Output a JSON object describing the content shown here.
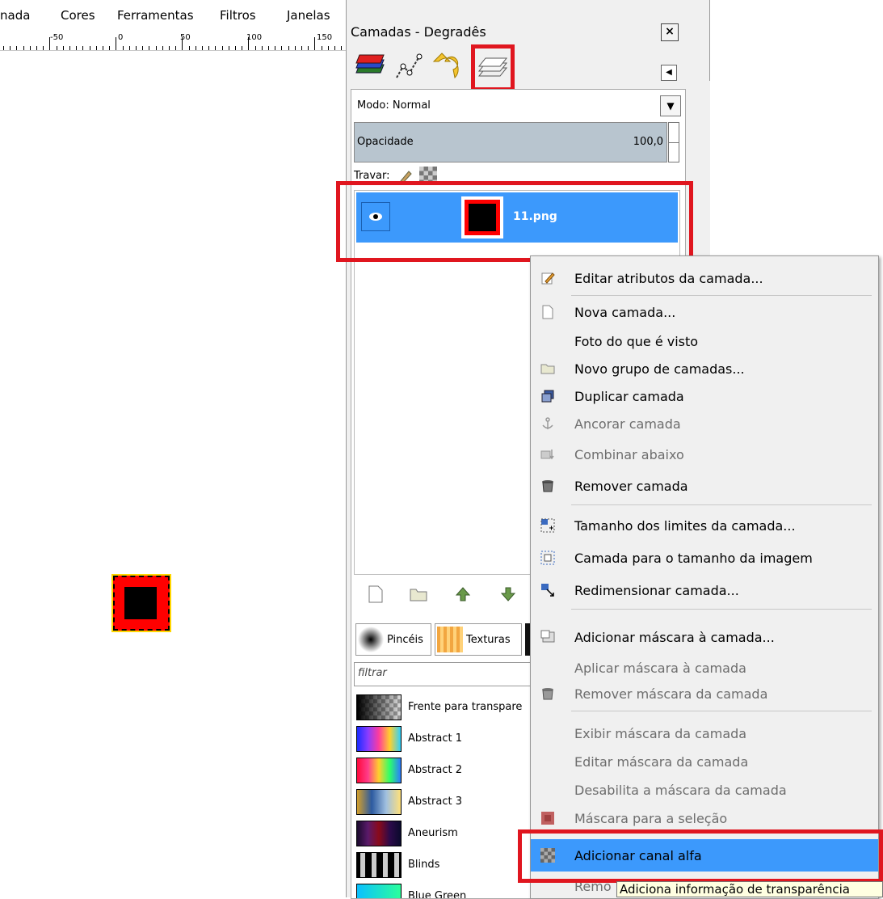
{
  "menubar": {
    "items": [
      "nada",
      "Cores",
      "Ferramentas",
      "Filtros",
      "Janelas"
    ]
  },
  "ruler": {
    "labels": [
      "-50",
      "0",
      "50",
      "100",
      "150"
    ]
  },
  "dock": {
    "title": "Camadas - Degradês",
    "close_glyph": "×",
    "menu_arrow_glyph": "◀",
    "mode_label": "Modo: Normal",
    "mode_arrow_glyph": "▼",
    "opacity_label": "Opacidade",
    "opacity_value": "100,0",
    "lock_label": "Travar:",
    "layer_name": "11.png",
    "filter_placeholder": "filtrar",
    "brush_tabs": [
      "Pincéis",
      "Texturas"
    ],
    "gradients": [
      "Frente para transpare",
      "Abstract 1",
      "Abstract 2",
      "Abstract 3",
      "Aneurism",
      "Blinds",
      "Blue Green"
    ]
  },
  "context_menu": {
    "items": [
      {
        "label": "Editar atributos da camada...",
        "icon": "edit-icon",
        "enabled": true
      },
      {
        "label": "Nova camada...",
        "icon": "new-file-icon",
        "enabled": true
      },
      {
        "label": "Foto do que é visto",
        "icon": "",
        "enabled": true
      },
      {
        "label": "Novo grupo de camadas...",
        "icon": "folder-icon",
        "enabled": true
      },
      {
        "label": "Duplicar camada",
        "icon": "duplicate-icon",
        "enabled": true
      },
      {
        "label": "Ancorar camada",
        "icon": "anchor-icon",
        "enabled": false
      },
      {
        "label": "Combinar abaixo",
        "icon": "merge-down-icon",
        "enabled": false
      },
      {
        "label": "Remover camada",
        "icon": "trash-icon",
        "enabled": true
      },
      {
        "label": "Tamanho dos limites da camada...",
        "icon": "boundary-size-icon",
        "enabled": true
      },
      {
        "label": "Camada para o tamanho da imagem",
        "icon": "fit-image-icon",
        "enabled": true
      },
      {
        "label": "Redimensionar camada...",
        "icon": "resize-icon",
        "enabled": true
      },
      {
        "label": "Adicionar máscara à camada...",
        "icon": "add-mask-icon",
        "enabled": true
      },
      {
        "label": "Aplicar máscara à camada",
        "icon": "",
        "enabled": false
      },
      {
        "label": "Remover máscara da camada",
        "icon": "trash-icon",
        "enabled": false
      },
      {
        "label": "Exibir máscara da camada",
        "icon": "",
        "enabled": false
      },
      {
        "label": "Editar máscara da camada",
        "icon": "",
        "enabled": false
      },
      {
        "label": "Desabilita a máscara da camada",
        "icon": "",
        "enabled": false
      },
      {
        "label": "Máscara para a seleção",
        "icon": "mask-selection-icon",
        "enabled": false
      },
      {
        "label": "Adicionar canal alfa",
        "icon": "alpha-icon",
        "enabled": true,
        "active": true
      },
      {
        "label": "Remo",
        "icon": "",
        "enabled": false
      }
    ],
    "tooltip": "Adiciona informação de transparência"
  }
}
